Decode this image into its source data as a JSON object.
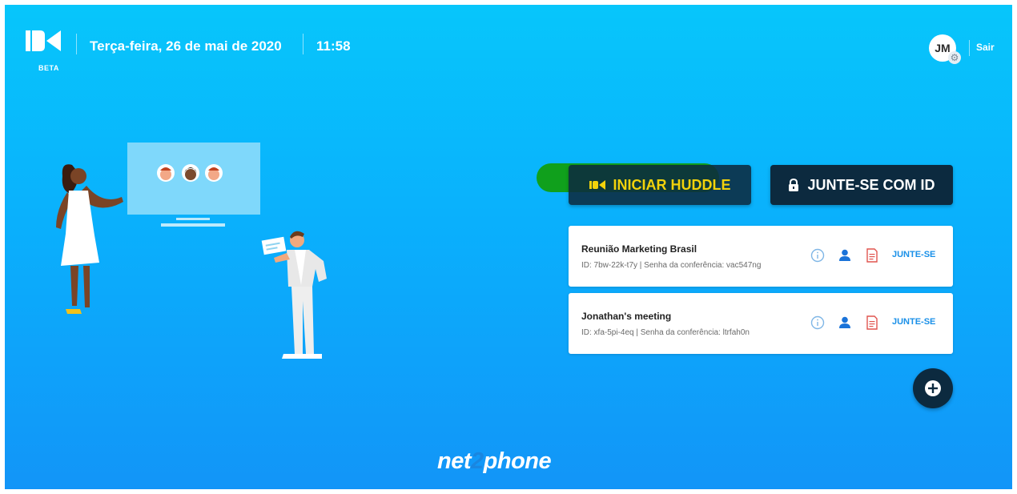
{
  "header": {
    "logo_icon": "video-camera-logo-icon",
    "beta_label": "BETA",
    "date": "Terça-feira, 26 de mai de 2020",
    "time": "11:58",
    "user_initials": "JM",
    "settings_icon": "gear-icon",
    "signout_label": "Sair"
  },
  "actions": {
    "start_label": "INICIAR HUDDLE",
    "start_icon": "video-camera-icon",
    "join_label": "JUNTE-SE COM ID",
    "join_icon": "lock-icon"
  },
  "meetings": [
    {
      "title": "Reunião Marketing Brasil",
      "meta": "ID: 7bw-22k-t7y | Senha da conferência: vac547ng",
      "join_label": "JUNTE-SE"
    },
    {
      "title": "Jonathan's meeting",
      "meta": "ID: xfa-5pi-4eq | Senha da conferência: ltrfah0n",
      "join_label": "JUNTE-SE"
    }
  ],
  "add_button_icon": "plus-icon",
  "brand": {
    "prefix": "net",
    "two": "2",
    "suffix": "phone"
  },
  "colors": {
    "background_top": "#07c6fb",
    "background_bottom": "#1295f8",
    "button_dark": "#0c2a3f",
    "start_text": "#f2d20b",
    "join_link": "#1a90e8",
    "pdf_icon": "#e0554f",
    "green_overlay": "#10a01c"
  }
}
